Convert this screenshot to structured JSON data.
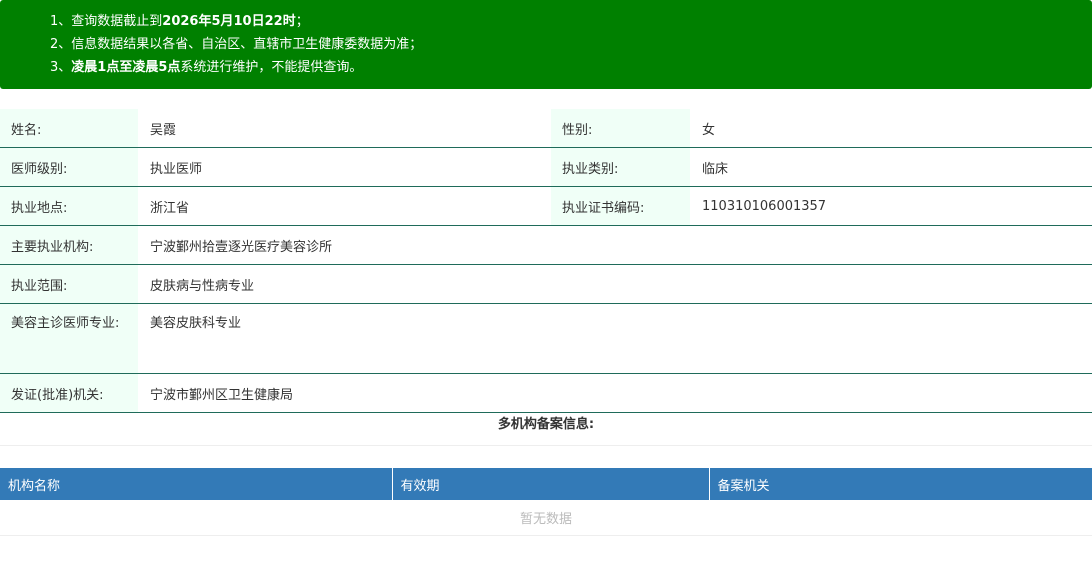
{
  "notice": {
    "line1_prefix": "1、查询数据截止到",
    "line1_date": "2026年5月10日22时",
    "line1_suffix": "；",
    "line2": "2、信息数据结果以各省、自治区、直辖市卫生健康委数据为准；",
    "line3_prefix": "3、",
    "line3_bold": "凌晨1点至凌晨5点",
    "line3_suffix": "系统进行维护，不能提供查询。"
  },
  "info": {
    "name_label": "姓名:",
    "name_value": "吴霞",
    "gender_label": "性别:",
    "gender_value": "女",
    "level_label": "医师级别:",
    "level_value": "执业医师",
    "category_label": "执业类别:",
    "category_value": "临床",
    "location_label": "执业地点:",
    "location_value": "浙江省",
    "cert_label": "执业证书编码:",
    "cert_value": "110310106001357",
    "org_label": "主要执业机构:",
    "org_value": "宁波鄞州拾壹逐光医疗美容诊所",
    "scope_label": "执业范围:",
    "scope_value": "皮肤病与性病专业",
    "beauty_label": "美容主诊医师专业:",
    "beauty_value": "美容皮肤科专业",
    "authority_label": "发证(批准)机关:",
    "authority_value": "宁波市鄞州区卫生健康局"
  },
  "multi": {
    "title": "多机构备案信息:",
    "columns": [
      "机构名称",
      "有效期",
      "备案机关"
    ],
    "empty_text": "暂无数据"
  }
}
